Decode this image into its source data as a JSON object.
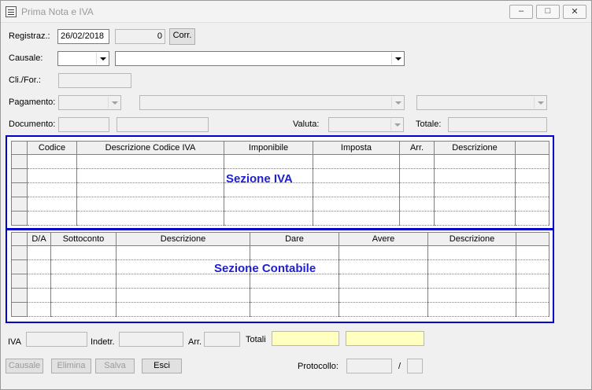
{
  "window": {
    "title": "Prima Nota  e IVA",
    "controls": {
      "minimize": "–",
      "maximize": "□",
      "close": "✕"
    }
  },
  "form": {
    "registraz_label": "Registraz.:",
    "registraz_date": "26/02/2018",
    "registraz_number": "0",
    "corr_button": "Corr.",
    "causale_label": "Causale:",
    "clifor_label": "Cli./For.:",
    "pagamento_label": "Pagamento:",
    "documento_label": "Documento:",
    "valuta_label": "Valuta:",
    "totale_label": "Totale:"
  },
  "sezione_iva": {
    "label": "Sezione IVA",
    "columns": [
      "",
      "Codice",
      "Descrizione Codice IVA",
      "Imponibile",
      "Imposta",
      "Arr.",
      "Descrizione",
      ""
    ]
  },
  "sezione_contabile": {
    "label": "Sezione Contabile",
    "columns": [
      "",
      "D/A",
      "Sottoconto",
      "Descrizione",
      "Dare",
      "Avere",
      "Descrizione",
      ""
    ]
  },
  "footer": {
    "iva_label": "IVA",
    "indetr_label": "Indetr.",
    "arr_label": "Arr.",
    "totali_label": "Totali",
    "protocollo_label": "Protocollo:",
    "protocollo_sep": "/",
    "buttons": {
      "causale": "Causale",
      "elimina": "Elimina",
      "salva": "Salva",
      "esci": "Esci"
    }
  }
}
